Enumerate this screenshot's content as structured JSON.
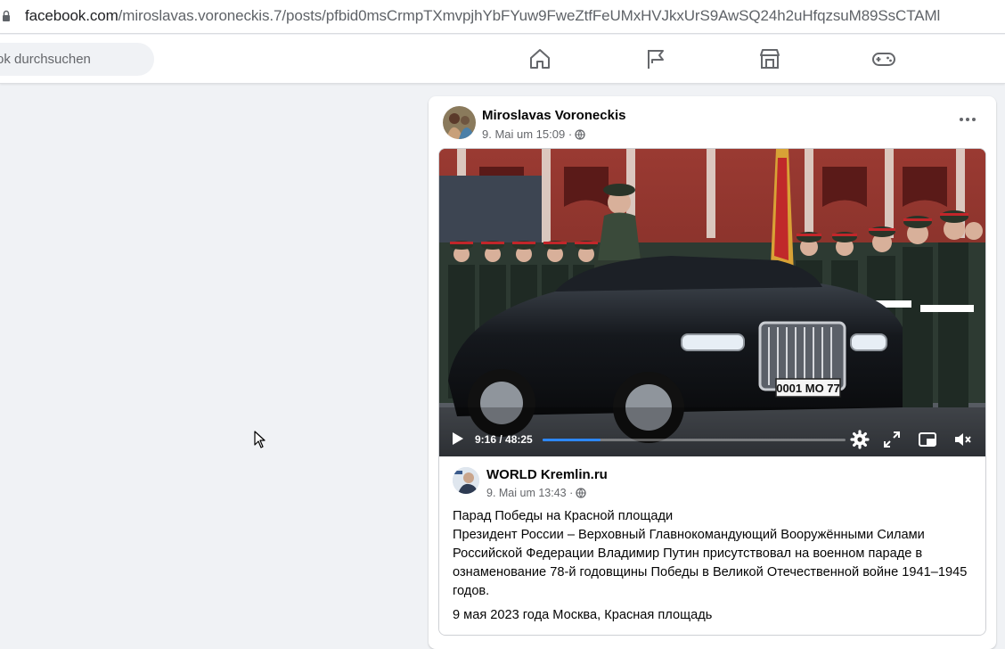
{
  "browser": {
    "url_domain": "facebook.com",
    "url_path": "/miroslavas.voroneckis.7/posts/pfbid0msCrmpTXmvpjhYbFYuw9FweZtfFeUMxHVJkxUrS9AwSQ24h2uHfqzsuM89SsCTAMl"
  },
  "header": {
    "search_placeholder": "ok durchsuchen",
    "nav": [
      {
        "icon": "home-icon"
      },
      {
        "icon": "flag-icon"
      },
      {
        "icon": "marketplace-icon"
      },
      {
        "icon": "gaming-icon"
      }
    ]
  },
  "post": {
    "author": "Miroslavas Voroneckis",
    "timestamp": "9. Mai um 15:09 ·",
    "audience_icon": "globe-icon",
    "video": {
      "current_time": "9:16 / 48:25",
      "progress": 0.19,
      "license_plate": "0001 МО 77"
    },
    "shared": {
      "author": "WORLD Kremlin.ru",
      "timestamp": "9. Mai um 13:43 ·",
      "title": "Парад Победы на Красной площади",
      "body": "Президент России – Верховный Главнокомандующий Вооружёнными Силами Российской Федерации Владимир Путин присутствовал на военном параде в ознаменование 78-й годовщины Победы в Великой Отечественной войне 1941–1945 годов.",
      "place": "9 мая 2023 года Москва, Красная площадь"
    }
  },
  "colors": {
    "accent": "#2d88ff",
    "page_bg": "#f0f2f5",
    "secondary_text": "#65676b"
  }
}
